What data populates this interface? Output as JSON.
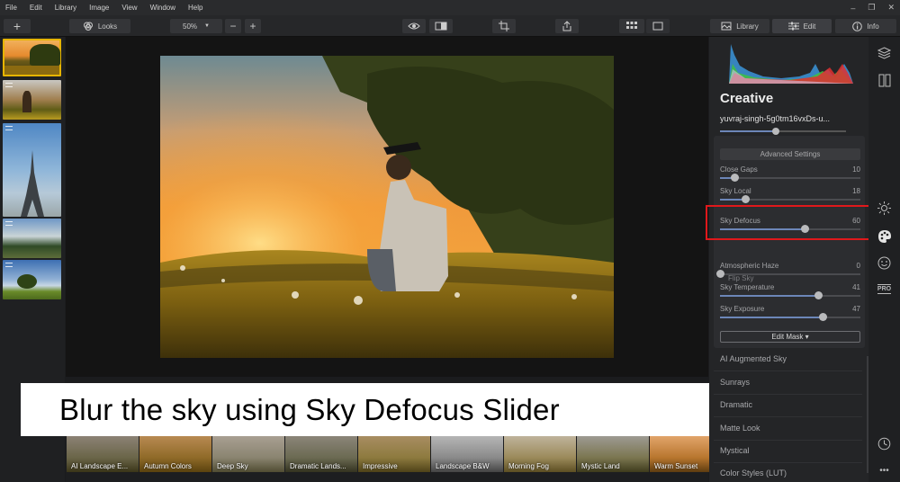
{
  "menu": [
    "File",
    "Edit",
    "Library",
    "Image",
    "View",
    "Window",
    "Help"
  ],
  "window_controls": [
    "–",
    "❐",
    "✕"
  ],
  "toolbar": {
    "add": "+",
    "looks": "Looks",
    "zoom": "50%",
    "zoom_minus": "−",
    "zoom_plus": "+",
    "library": "Library",
    "edit": "Edit",
    "info": "Info"
  },
  "panel": {
    "title": "Creative",
    "preset": "yuvraj-singh-5g0tm16vxDs-u...",
    "advanced": "Advanced Settings",
    "sliders": [
      {
        "label": "Close Gaps",
        "value": "10",
        "level": 0.1
      },
      {
        "label": "Sky Local",
        "value": "18",
        "level": 0.18
      },
      {
        "label": "Sky Defocus",
        "value": "60",
        "level": 0.6
      },
      {
        "label": "Atmospheric Haze",
        "value": "0",
        "level": 0.0
      },
      {
        "label": "Sky Temperature",
        "value": "41",
        "level": 0.7
      },
      {
        "label": "Sky Exposure",
        "value": "47",
        "level": 0.73
      }
    ],
    "flip_sky": "Flip Sky",
    "edit_mask": "Edit Mask ▾",
    "categories": [
      "AI Augmented Sky",
      "Sunrays",
      "Dramatic",
      "Matte Look",
      "Mystical",
      "Color Styles (LUT)"
    ]
  },
  "caption": "Blur the sky using Sky Defocus Slider",
  "looks": [
    "AI Landscape E...",
    "Autumn Colors",
    "Deep Sky",
    "Dramatic Lands...",
    "Impressive",
    "Landscape B&W",
    "Morning Fog",
    "Mystic Land",
    "Warm Sunset"
  ],
  "rail_icons": [
    "layers-icon",
    "canvas-icon",
    "sun-icon",
    "palette-icon",
    "face-icon",
    "pro-icon",
    "history-icon",
    "more-icon"
  ],
  "rail_pro": "PRO",
  "colors": {
    "accent": "#6c86b8",
    "highlight": "#e0181b"
  }
}
